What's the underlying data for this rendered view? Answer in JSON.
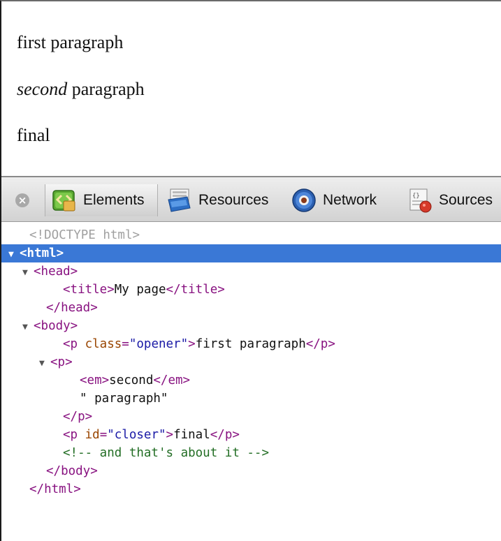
{
  "page": {
    "p1": "first paragraph",
    "p2_em": "second",
    "p2_rest": " paragraph",
    "p3": "final"
  },
  "toolbar": {
    "close_glyph": "×",
    "tabs": [
      {
        "label": "Elements",
        "icon": "elements-icon",
        "active": true
      },
      {
        "label": "Resources",
        "icon": "resources-icon",
        "active": false
      },
      {
        "label": "Network",
        "icon": "network-icon",
        "active": false
      },
      {
        "label": "Sources",
        "icon": "sources-icon",
        "active": false
      }
    ]
  },
  "tree": {
    "doctype": "<!DOCTYPE html>",
    "html_open": "<html>",
    "head_open": "<head>",
    "title_open": "<title>",
    "title_text": "My page",
    "title_close": "</title>",
    "head_close": "</head>",
    "body_open": "<body>",
    "p1_open_start": "<p ",
    "p1_attr_name": "class",
    "p1_attr_eq": "=",
    "p1_attr_val": "\"opener\"",
    "p1_open_end": ">",
    "p1_text": "first paragraph",
    "p_close": "</p>",
    "p2_open": "<p>",
    "em_open": "<em>",
    "em_text": "second",
    "em_close": "</em>",
    "p2_textnode": "\" paragraph\"",
    "p2_close": "</p>",
    "p3_open_start": "<p ",
    "p3_attr_name": "id",
    "p3_attr_eq": "=",
    "p3_attr_val": "\"closer\"",
    "p3_open_end": ">",
    "p3_text": "final",
    "p3_close": "</p>",
    "comment": "<!-- and that's about it -->",
    "body_close": "</body>",
    "html_close": "</html>",
    "expanded_glyph": "▼"
  },
  "colors": {
    "selection": "#3a78d6",
    "tag": "#881280",
    "attr_name": "#994500",
    "attr_value": "#1a1aa6",
    "comment": "#236e25"
  }
}
